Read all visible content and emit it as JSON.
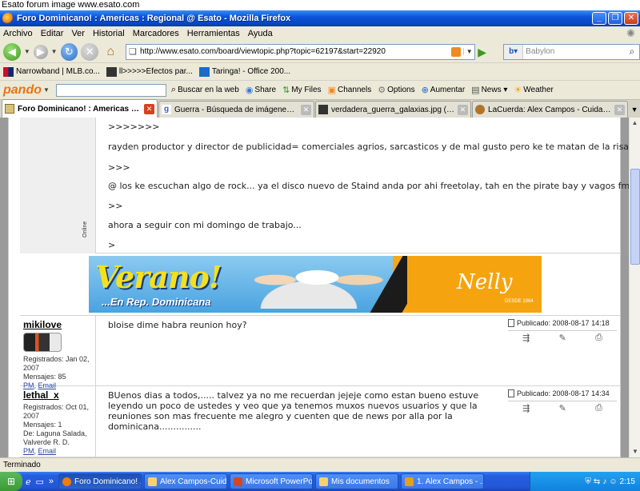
{
  "caption": "Esato forum image www.esato.com",
  "window": {
    "title": "Foro Dominicano! : Americas : Regional @ Esato - Mozilla Firefox"
  },
  "menu": [
    "Archivo",
    "Editar",
    "Ver",
    "Historial",
    "Marcadores",
    "Herramientas",
    "Ayuda"
  ],
  "nav": {
    "url": "http://www.esato.com/board/viewtopic.php?topic=62197&start=22920",
    "search_placeholder": "Babylon"
  },
  "bookmarks": [
    "Narrowband | MLB.co...",
    "ll>>>>>Efectos par...",
    "Taringa! - Office 200..."
  ],
  "pando": {
    "logo": "pando",
    "buttons": [
      "Buscar en la web",
      "Share",
      "My Files",
      "Channels",
      "Options",
      "Aumentar",
      "News",
      "Weather"
    ]
  },
  "tabs": [
    {
      "label": "Foro Dominicano! : Americas : Re...",
      "active": true
    },
    {
      "label": "Guerra - Búsqueda de imágenes de Go...",
      "active": false
    },
    {
      "label": "verdadera_guerra_galaxias.jpg (JPEG...",
      "active": false
    },
    {
      "label": "LaCuerda: Alex Campos - Cuidaré de ti",
      "active": false
    }
  ],
  "post_top": {
    "online": "Online",
    "lines": [
      ">>>>>>>",
      "rayden productor y director de publicidad= comerciales agrios, sarcasticos y de mal gusto pero ke te matan de la risa...",
      ">>>",
      "@ los ke escuchan algo de rock... ya el disco nuevo de Staind anda por ahi freetolay, tah en the pirate bay y vagos fm",
      ">>",
      "ahora a seguir con mi domingo de trabajo...",
      ">"
    ]
  },
  "banner": {
    "title": "Verano!",
    "subtitle": "...En Rep. Dominicana",
    "brand": "Nelly",
    "since": "DESDE 1964"
  },
  "posts": [
    {
      "username": "mikilove",
      "info": [
        "Registrados: Jan 02, 2007",
        "Mensajes: 85"
      ],
      "pm": "PM",
      "email": "Email",
      "text": "bloise dime habra reunion hoy?",
      "published": "Publicado: 2008-08-17 14:18"
    },
    {
      "username": "lethal_x",
      "info": [
        "Registrados: Oct 01, 2007",
        "Mensajes: 1",
        "De: Laguna Salada, Valverde R. D."
      ],
      "pm": "PM",
      "email": "Email",
      "text": "BUenos dias a todos,..... talvez ya no me recuerdan jejeje como estan bueno estuve leyendo un poco de ustedes y veo que ya tenemos muxos nuevos usuarios y que la reuniones son mas frecuente me alegro y cuenten que de news por alla por la dominicana...............",
      "published": "Publicado: 2008-08-17 14:34"
    }
  ],
  "status": "Terminado",
  "taskbar": {
    "items": [
      "Foro Dominicano! ...",
      "Alex Campos-Cuid...",
      "Microsoft PowerPo...",
      "Mis documentos",
      "1. Alex Campos - ..."
    ],
    "active_index": 0,
    "clock": "2:15"
  }
}
